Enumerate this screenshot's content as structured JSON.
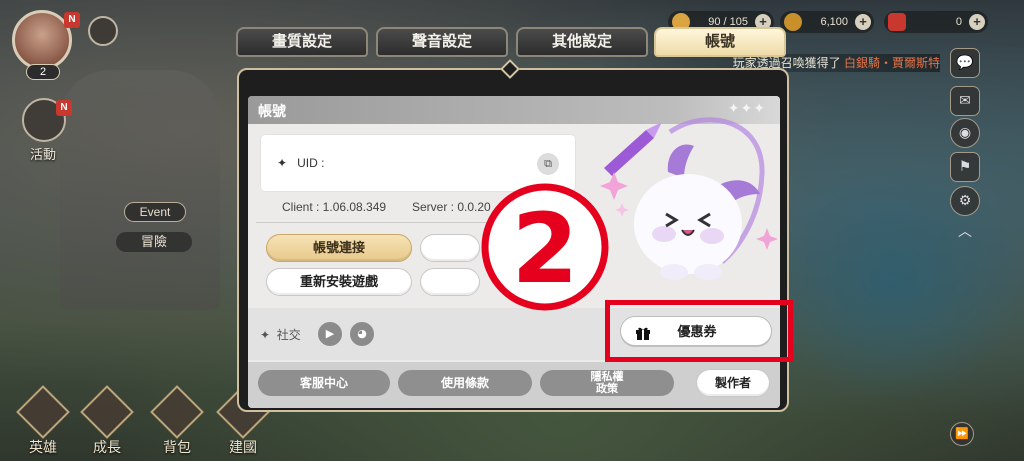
{
  "hud": {
    "level": "2",
    "badge_n": "N",
    "activity_label": "活動",
    "event_label": "Event",
    "adventure_label": "冒險",
    "resources": [
      {
        "value": "90 / 105",
        "icon": "stamina-icon",
        "color": "#d9a441"
      },
      {
        "value": "6,100",
        "icon": "gold-coin-icon",
        "color": "#c98f2a"
      },
      {
        "value": "0",
        "icon": "gem-icon",
        "color": "#c8382f"
      }
    ],
    "ticker_prefix": "玩家透過召喚獲得了",
    "ticker_highlight": "白銀騎‧賈爾斯特"
  },
  "bottom_nav": [
    "英雄",
    "成長",
    "背包",
    "建國"
  ],
  "tabs": [
    {
      "label": "畫質設定",
      "active": false
    },
    {
      "label": "聲音設定",
      "active": false
    },
    {
      "label": "其他設定",
      "active": false
    },
    {
      "label": "帳號",
      "active": true
    }
  ],
  "account": {
    "panel_title": "帳號",
    "header_decoration": "✦✦✦",
    "uid_label": "UID :",
    "uid_bullet": "✦",
    "client_version": "Client : 1.06.08.349",
    "server_version": "Server : 0.0.20",
    "buttons": {
      "link_account": "帳號連接",
      "reinstall": "重新安裝遊戲"
    },
    "social_label": "社交",
    "social_bullet": "✦",
    "coupon_label": "優惠券",
    "footer": {
      "support": "客服中心",
      "terms": "使用條款",
      "privacy": "隱私權\n政策",
      "credits": "製作者"
    }
  },
  "annotation": {
    "step_number": "②",
    "highlight_color": "#e5001e"
  }
}
